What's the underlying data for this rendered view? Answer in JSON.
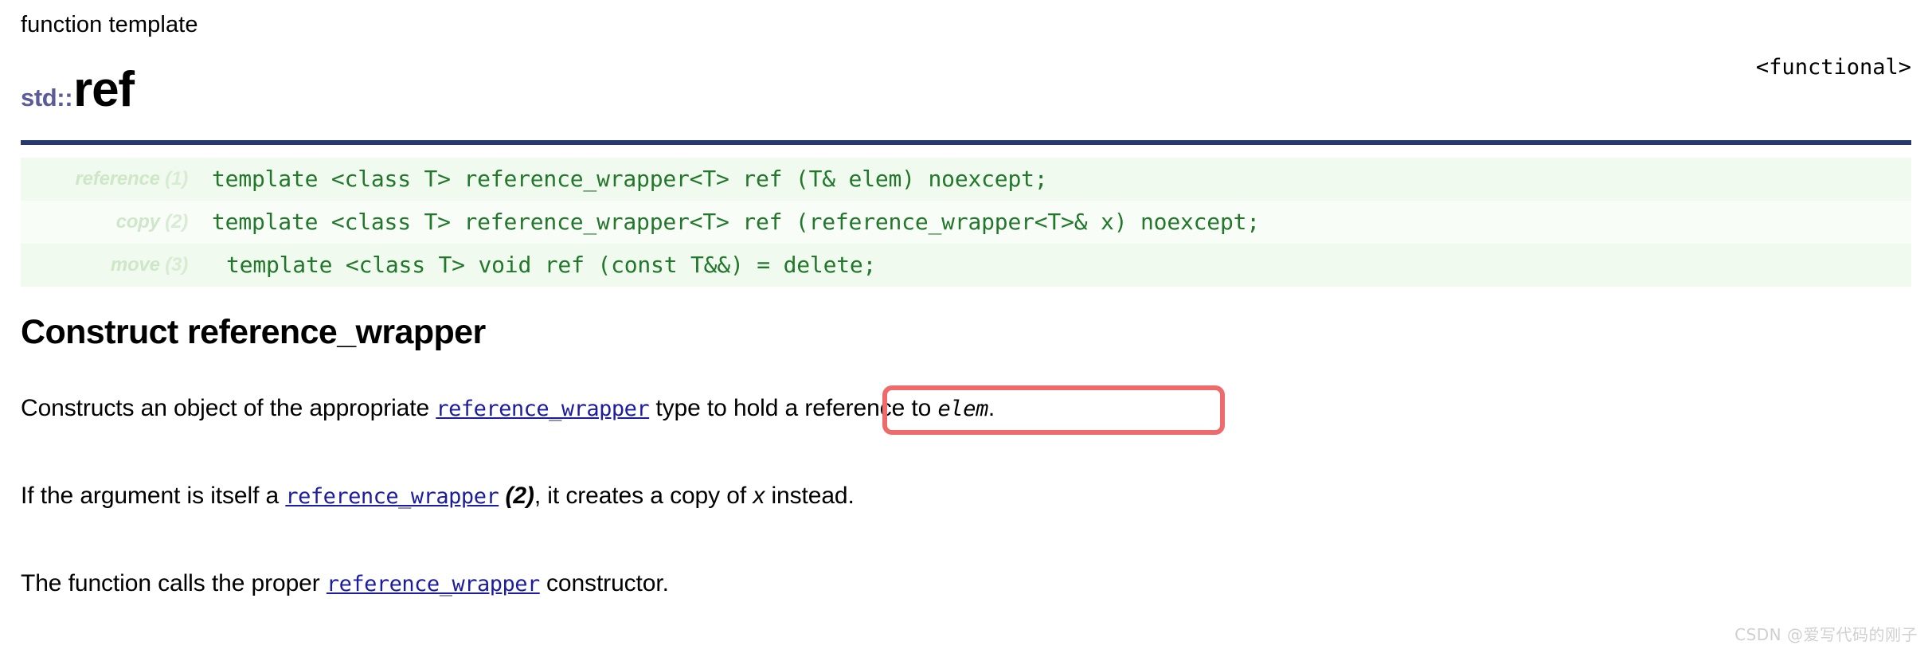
{
  "header": {
    "kind": "function template",
    "namespace": "std::",
    "name": "ref",
    "include": "<functional>",
    "rule_color": "#27386d",
    "namespace_color": "#5b5b9c"
  },
  "prototypes": {
    "rows": [
      {
        "tag_name": "reference",
        "tag_num": "(1)",
        "code": "template <class T> reference_wrapper<T> ref (T& elem) noexcept;"
      },
      {
        "tag_name": "copy",
        "tag_num": "(2)",
        "code": "template <class T> reference_wrapper<T> ref (reference_wrapper<T>& x) noexcept;"
      },
      {
        "tag_name": "move",
        "tag_num": "(3)",
        "code": "template <class T> void ref (const T&&) = delete;"
      }
    ],
    "code_color": "#21772a",
    "row_bg_a": "#f0faee",
    "row_bg_b": "#f8fdf7"
  },
  "section": {
    "heading": "Construct reference_wrapper"
  },
  "paragraphs": {
    "p1": {
      "part1": "Constructs an object of the appropriate ",
      "link": "reference_wrapper",
      "part2": " type to hold a reference to ",
      "emphasis": "elem",
      "part3": "."
    },
    "p2": {
      "part1": "If the argument is itself a ",
      "link": "reference_wrapper",
      "part2": " ",
      "overload_num": "(2)",
      "part3": ", it creates a copy of ",
      "emphasis": "x",
      "part4": " instead."
    },
    "p3": {
      "part1": "The function calls the proper ",
      "link": "reference_wrapper",
      "part2": " constructor."
    },
    "link_color": "#1c1ca0"
  },
  "annotation": {
    "label": "highlight-box",
    "color": "#ef6b6b"
  },
  "watermark": {
    "text": "CSDN @爱写代码的刚子"
  }
}
